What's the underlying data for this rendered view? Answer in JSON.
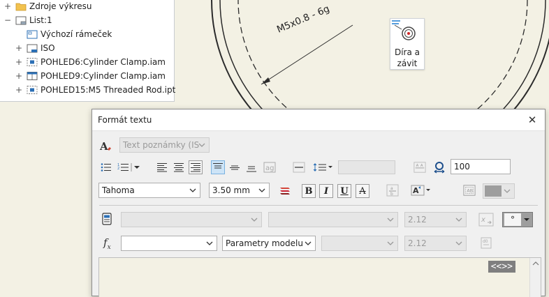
{
  "tree": {
    "items": [
      {
        "label": "Zdroje výkresu",
        "toggle": "+",
        "icon": "folder-icon"
      },
      {
        "label": "List:1",
        "toggle": "−",
        "icon": "sheet-icon"
      },
      {
        "label": "Výchozí rámeček",
        "toggle": "",
        "icon": "border-icon"
      },
      {
        "label": "ISO",
        "toggle": "+",
        "icon": "title-block-icon"
      },
      {
        "label": "POHLED6:Cylinder Clamp.iam",
        "toggle": "+",
        "icon": "view-icon"
      },
      {
        "label": "POHLED9:Cylinder Clamp.iam",
        "toggle": "+",
        "icon": "view-icon"
      },
      {
        "label": "POHLED15:M5 Threaded Rod.ipt",
        "toggle": "+",
        "icon": "view-icon"
      }
    ]
  },
  "canvas": {
    "callout_text": "M5x0.8 - 6g",
    "hole_tool_label_line1": "Díra a",
    "hole_tool_label_line2": "závit"
  },
  "dialog": {
    "title": "Formát textu",
    "style_select": "Text poznámky (IS",
    "line_spacing_value": "",
    "stretch_value": "100",
    "font_select": "Tahoma",
    "size_select": "3.50 mm",
    "bold_label": "B",
    "italic_label": "I",
    "underline_label": "U",
    "strike_label": "A",
    "param_row1_value": "2.12",
    "symbol_select": "°",
    "param_source_select": "Parametry modelu",
    "param_row2_value": "2.12",
    "text_content": "<<>>"
  },
  "colors": {
    "canvas_bg": "#f3f1e4",
    "accent": "#0078d7",
    "active_bg": "#cde4f7"
  }
}
